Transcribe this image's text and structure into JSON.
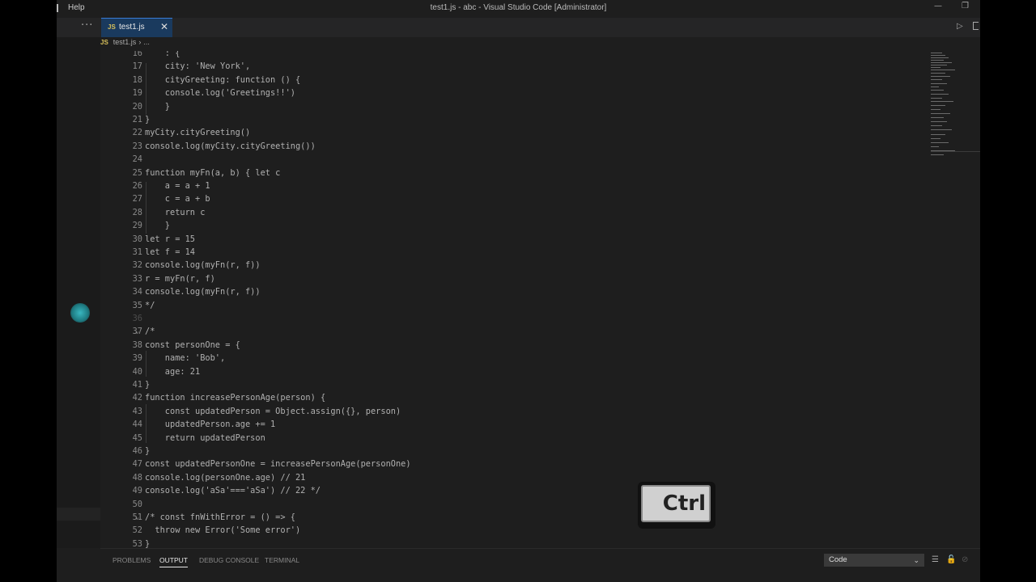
{
  "titlebar": {
    "menu_help": "Help",
    "title": "test1.js - abc - Visual Studio Code [Administrator]",
    "minimize_glyph": "—",
    "restore_glyph": "❐"
  },
  "tabs": {
    "more_glyph": "···",
    "active_tab": {
      "icon": "JS",
      "label": "test1.js",
      "close_glyph": "✕"
    },
    "run_glyph": "▷"
  },
  "breadcrumb": {
    "icon": "JS",
    "file": "test1.js",
    "separator": "›",
    "rest": "..."
  },
  "editor": {
    "lines": [
      {
        "n": "16",
        "text": "    : {"
      },
      {
        "n": "17",
        "text": "    city: 'New York',"
      },
      {
        "n": "18",
        "text": "    cityGreeting: function () {"
      },
      {
        "n": "19",
        "text": "    console.log('Greetings!!')"
      },
      {
        "n": "20",
        "text": "    }"
      },
      {
        "n": "21",
        "text": "}"
      },
      {
        "n": "22",
        "text": "myCity.cityGreeting()"
      },
      {
        "n": "23",
        "text": "console.log(myCity.cityGreeting())"
      },
      {
        "n": "24",
        "text": ""
      },
      {
        "n": "25",
        "text": "function myFn(a, b) { let c"
      },
      {
        "n": "26",
        "text": "    a = a + 1"
      },
      {
        "n": "27",
        "text": "    c = a + b"
      },
      {
        "n": "28",
        "text": "    return c"
      },
      {
        "n": "29",
        "text": "    }"
      },
      {
        "n": "30",
        "text": "let r = 15"
      },
      {
        "n": "31",
        "text": "let f = 14"
      },
      {
        "n": "32",
        "text": "console.log(myFn(r, f))"
      },
      {
        "n": "33",
        "text": "r = myFn(r, f)"
      },
      {
        "n": "34",
        "text": "console.log(myFn(r, f))"
      },
      {
        "n": "35",
        "text": "*/"
      },
      {
        "n": "36",
        "text": ""
      },
      {
        "n": "37",
        "text": "/*"
      },
      {
        "n": "38",
        "text": "const personOne = {"
      },
      {
        "n": "39",
        "text": "    name: 'Bob',"
      },
      {
        "n": "40",
        "text": "    age: 21"
      },
      {
        "n": "41",
        "text": "}"
      },
      {
        "n": "42",
        "text": "function increasePersonAge(person) {"
      },
      {
        "n": "43",
        "text": "    const updatedPerson = Object.assign({}, person)"
      },
      {
        "n": "44",
        "text": "    updatedPerson.age += 1"
      },
      {
        "n": "45",
        "text": "    return updatedPerson"
      },
      {
        "n": "46",
        "text": "}"
      },
      {
        "n": "47",
        "text": "const updatedPersonOne = increasePersonAge(personOne)"
      },
      {
        "n": "48",
        "text": "console.log(personOne.age) // 21"
      },
      {
        "n": "49",
        "text": "console.log('aSa'==='aSa') // 22 */"
      },
      {
        "n": "50",
        "text": ""
      },
      {
        "n": "51",
        "text": "/* const fnWithError = () => {"
      },
      {
        "n": "52",
        "text": "  throw new Error('Some error')"
      },
      {
        "n": "53",
        "text": "}"
      }
    ],
    "fold_glyphs": [
      "⌄",
      "⌄"
    ]
  },
  "key_overlay": {
    "label": "Ctrl"
  },
  "panel": {
    "tabs": [
      "PROBLEMS",
      "OUTPUT",
      "DEBUG CONSOLE",
      "TERMINAL"
    ],
    "active_tab": "OUTPUT",
    "output_channel": "Code",
    "chevron_glyph": "⌄",
    "wrap_glyph": "☰",
    "lock_glyph": "🔓",
    "clear_glyph": "⊘"
  }
}
